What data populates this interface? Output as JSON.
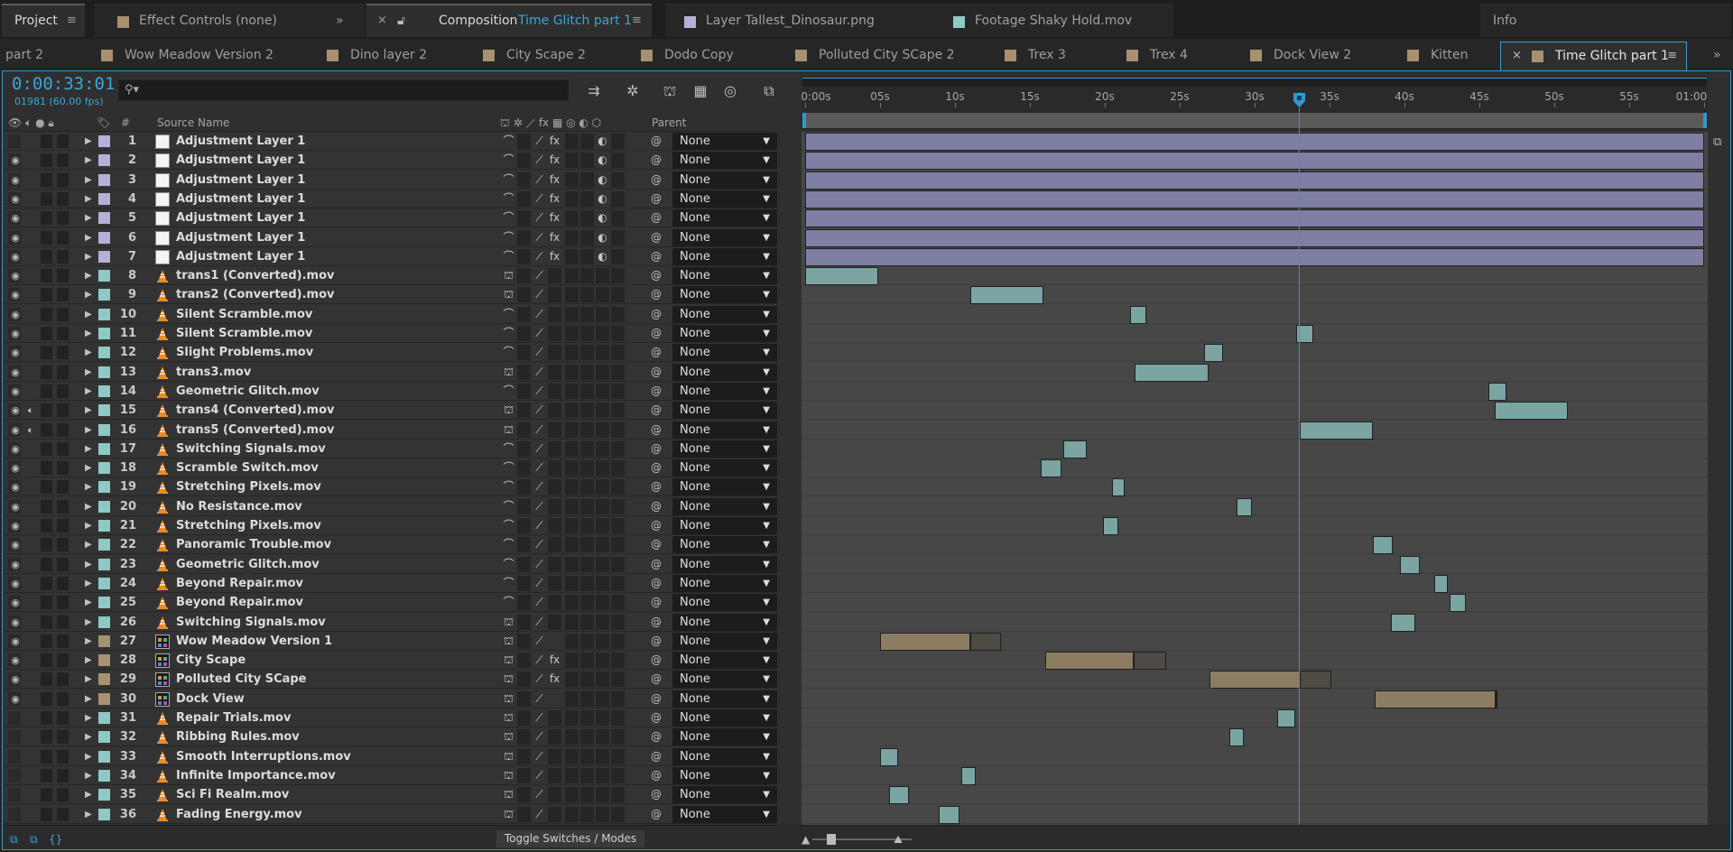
{
  "panels": [
    {
      "label": "Project",
      "active": true
    },
    {
      "label": "Effect Controls (none)"
    },
    {
      "label": "Composition",
      "sub": "Time Glitch part 1"
    },
    {
      "label": "Layer Tallest_Dinosaur.png"
    },
    {
      "label": "Footage Shaky Hold.mov"
    },
    {
      "label": "Info"
    }
  ],
  "overflow_icon": "»",
  "comp_tabs": [
    {
      "label": "part 2",
      "color": ""
    },
    {
      "label": "Wow Meadow Version 2",
      "color": "#a89070"
    },
    {
      "label": "Dino layer 2",
      "color": "#a89070"
    },
    {
      "label": "City Scape 2",
      "color": "#a89070"
    },
    {
      "label": "Dodo Copy",
      "color": "#a89070"
    },
    {
      "label": "Polluted City SCape 2",
      "color": "#a89070"
    },
    {
      "label": "Trex 3",
      "color": "#a89070"
    },
    {
      "label": "Trex 4",
      "color": "#a89070"
    },
    {
      "label": "Dock View 2",
      "color": "#a89070"
    },
    {
      "label": "Kitten",
      "color": "#a89070"
    },
    {
      "label": "Time Glitch part 1",
      "color": "#a89070",
      "active": true
    }
  ],
  "timecode": "0:00:33:01",
  "fps": "01981 (60.00 fps)",
  "search_placeholder": "",
  "columns": {
    "source_name": "Source Name",
    "parent": "Parent",
    "num": "#"
  },
  "ruler_ticks": [
    "0:00s",
    "05s",
    "10s",
    "15s",
    "20s",
    "25s",
    "30s",
    "35s",
    "40s",
    "45s",
    "50s",
    "55s",
    "01:00"
  ],
  "toggle_label": "Toggle Switches / Modes",
  "colors": {
    "accent": "#3aa6d8",
    "adj_label": "#b5b0d8",
    "mov_label": "#8fc9c6",
    "comp_label": "#a89070",
    "adj_bar": "#7f7ea3",
    "mov_bar": "#7aa5a3",
    "comp_bar": "#8c7c61"
  },
  "duration_s": 60,
  "layers": [
    {
      "n": "1",
      "name": "Adjustment Layer 1",
      "kind": "adj",
      "parent": "None",
      "start": 0,
      "end": 60,
      "eye": false
    },
    {
      "n": "2",
      "name": "Adjustment Layer 1",
      "kind": "adj",
      "parent": "None",
      "start": 0,
      "end": 60,
      "eye": true
    },
    {
      "n": "3",
      "name": "Adjustment Layer 1",
      "kind": "adj",
      "parent": "None",
      "start": 0,
      "end": 60,
      "eye": true
    },
    {
      "n": "4",
      "name": "Adjustment Layer 1",
      "kind": "adj",
      "parent": "None",
      "start": 0,
      "end": 60,
      "eye": true
    },
    {
      "n": "5",
      "name": "Adjustment Layer 1",
      "kind": "adj",
      "parent": "None",
      "start": 0,
      "end": 60,
      "eye": true
    },
    {
      "n": "6",
      "name": "Adjustment Layer 1",
      "kind": "adj",
      "parent": "None",
      "start": 0,
      "end": 60,
      "eye": true
    },
    {
      "n": "7",
      "name": "Adjustment Layer 1",
      "kind": "adj",
      "parent": "None",
      "start": 0,
      "end": 60,
      "eye": true
    },
    {
      "n": "8",
      "name": "trans1 (Converted).mov",
      "kind": "mov",
      "parent": "None",
      "start": 0,
      "end": 4.9,
      "eye": true
    },
    {
      "n": "9",
      "name": "trans2 (Converted).mov",
      "kind": "mov",
      "parent": "None",
      "start": 11.0,
      "end": 15.9,
      "eye": true
    },
    {
      "n": "10",
      "name": "Silent Scramble.mov",
      "kind": "mov",
      "parent": "None",
      "start": 21.7,
      "end": 22.8,
      "eye": true
    },
    {
      "n": "11",
      "name": "Silent Scramble.mov",
      "kind": "mov",
      "parent": "None",
      "start": 32.8,
      "end": 33.9,
      "eye": true
    },
    {
      "n": "12",
      "name": "Slight Problems.mov",
      "kind": "mov",
      "parent": "None",
      "start": 26.6,
      "end": 27.9,
      "eye": true
    },
    {
      "n": "13",
      "name": "trans3.mov",
      "kind": "mov",
      "parent": "None",
      "start": 22.0,
      "end": 26.9,
      "eye": true
    },
    {
      "n": "14",
      "name": "Geometric Glitch.mov",
      "kind": "mov",
      "parent": "None",
      "start": 45.6,
      "end": 46.8,
      "eye": true
    },
    {
      "n": "15",
      "name": "trans4 (Converted).mov",
      "kind": "mov",
      "parent": "None",
      "start": 46.0,
      "end": 50.9,
      "eye": true,
      "audio": true
    },
    {
      "n": "16",
      "name": "trans5 (Converted).mov",
      "kind": "mov",
      "parent": "None",
      "start": 33.0,
      "end": 37.9,
      "eye": true,
      "audio": true
    },
    {
      "n": "17",
      "name": "Switching Signals.mov",
      "kind": "mov",
      "parent": "None",
      "start": 17.2,
      "end": 18.8,
      "eye": true
    },
    {
      "n": "18",
      "name": "Scramble Switch.mov",
      "kind": "mov",
      "parent": "None",
      "start": 15.7,
      "end": 17.1,
      "eye": true
    },
    {
      "n": "19",
      "name": "Stretching Pixels.mov",
      "kind": "mov",
      "parent": "None",
      "start": 20.5,
      "end": 21.3,
      "eye": true
    },
    {
      "n": "20",
      "name": "No Resistance.mov",
      "kind": "mov",
      "parent": "None",
      "start": 28.8,
      "end": 29.8,
      "eye": true
    },
    {
      "n": "21",
      "name": "Stretching Pixels.mov",
      "kind": "mov",
      "parent": "None",
      "start": 19.9,
      "end": 20.9,
      "eye": true
    },
    {
      "n": "22",
      "name": "Panoramic Trouble.mov",
      "kind": "mov",
      "parent": "None",
      "start": 37.9,
      "end": 39.2,
      "eye": true
    },
    {
      "n": "23",
      "name": "Geometric Glitch.mov",
      "kind": "mov",
      "parent": "None",
      "start": 39.7,
      "end": 41.0,
      "eye": true
    },
    {
      "n": "24",
      "name": "Beyond Repair.mov",
      "kind": "mov",
      "parent": "None",
      "start": 42.0,
      "end": 42.9,
      "eye": true
    },
    {
      "n": "25",
      "name": "Beyond Repair.mov",
      "kind": "mov",
      "parent": "None",
      "start": 43.0,
      "end": 44.1,
      "eye": true
    },
    {
      "n": "26",
      "name": "Switching Signals.mov",
      "kind": "mov",
      "parent": "None",
      "start": 39.1,
      "end": 40.7,
      "eye": true
    },
    {
      "n": "27",
      "name": "Wow Meadow Version 1",
      "kind": "comp",
      "parent": "None",
      "start": 5.0,
      "end": 11.0,
      "ghostEnd": 13.1,
      "eye": true
    },
    {
      "n": "28",
      "name": "City Scape",
      "kind": "comp",
      "parent": "None",
      "start": 16.0,
      "end": 21.9,
      "ghostEnd": 24.1,
      "eye": true
    },
    {
      "n": "29",
      "name": "Polluted City SCape",
      "kind": "comp",
      "parent": "None",
      "start": 27.0,
      "end": 33.0,
      "ghostEnd": 35.1,
      "eye": true
    },
    {
      "n": "30",
      "name": "Dock View",
      "kind": "comp",
      "parent": "None",
      "start": 38.0,
      "end": 46.1,
      "ghostEnd": 46.2,
      "eye": true
    },
    {
      "n": "31",
      "name": "Repair Trials.mov",
      "kind": "mov",
      "parent": "None",
      "start": 31.5,
      "end": 32.7,
      "eye": false
    },
    {
      "n": "32",
      "name": "Ribbing Rules.mov",
      "kind": "mov",
      "parent": "None",
      "start": 28.3,
      "end": 29.3,
      "eye": false
    },
    {
      "n": "33",
      "name": "Smooth Interruptions.mov",
      "kind": "mov",
      "parent": "None",
      "start": 5.0,
      "end": 6.2,
      "eye": false
    },
    {
      "n": "34",
      "name": "Infinite Importance.mov",
      "kind": "mov",
      "parent": "None",
      "start": 10.4,
      "end": 11.4,
      "eye": false
    },
    {
      "n": "35",
      "name": "Sci Fi Realm.mov",
      "kind": "mov",
      "parent": "None",
      "start": 5.6,
      "end": 6.9,
      "eye": false
    },
    {
      "n": "36",
      "name": "Fading Energy.mov",
      "kind": "mov",
      "parent": "None",
      "start": 8.9,
      "end": 10.3,
      "eye": false
    }
  ]
}
